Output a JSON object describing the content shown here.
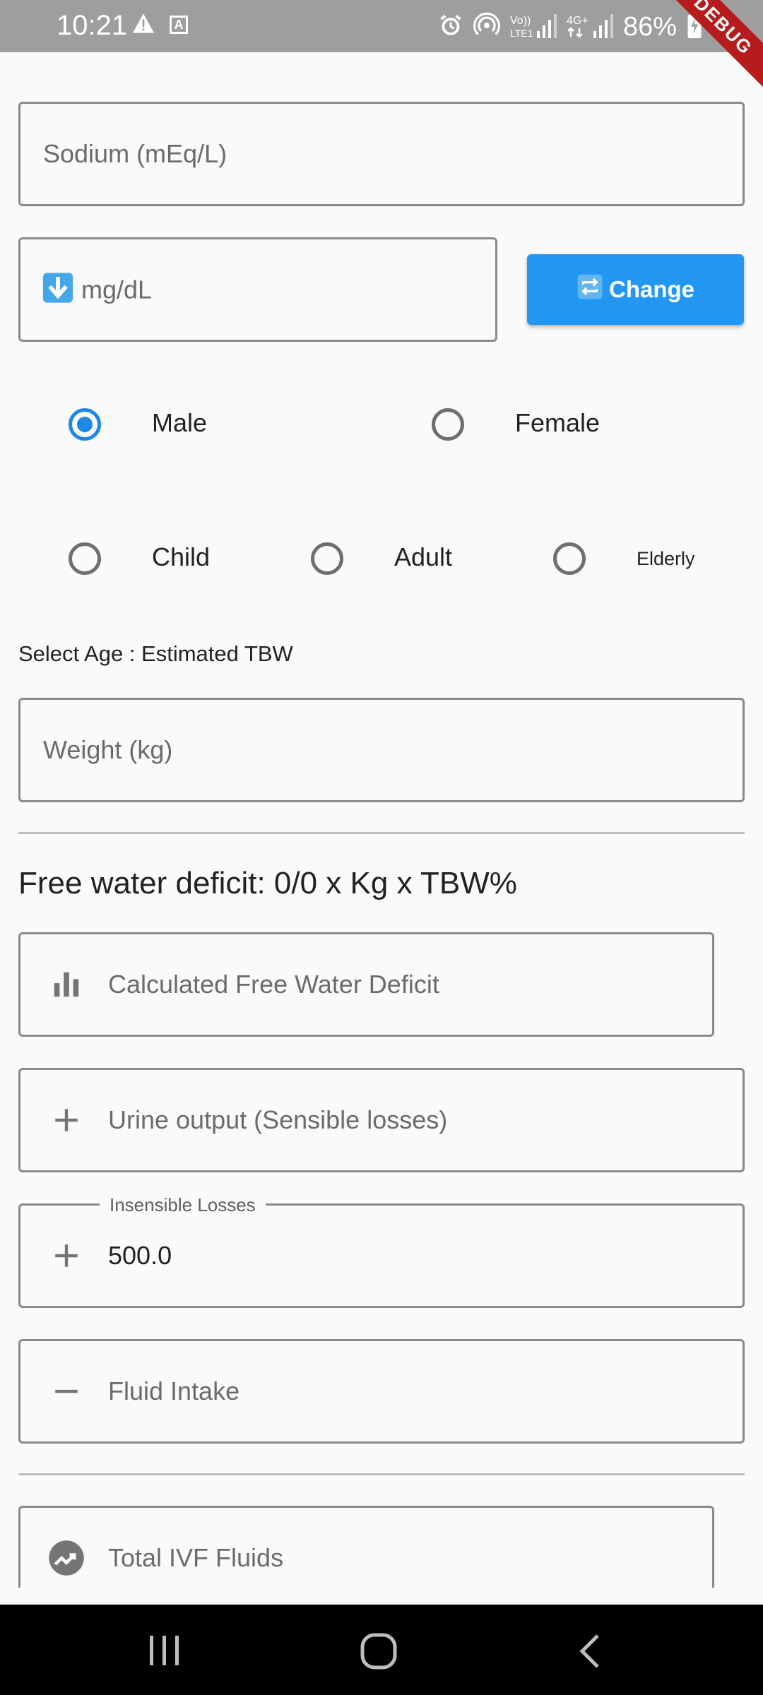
{
  "status_bar": {
    "time": "10:21",
    "battery": "86%",
    "debug_banner": "DEBUG"
  },
  "sodium": {
    "placeholder": "Sodium (mEq/L)"
  },
  "unit": {
    "icon": "down-arrow-emoji",
    "text": "mg/dL"
  },
  "change_button": {
    "label": "Change",
    "icon": "repeat-emoji"
  },
  "sex": {
    "options": [
      "Male",
      "Female"
    ],
    "selected": "Male"
  },
  "age_group": {
    "options": [
      "Child",
      "Adult",
      "Elderly"
    ],
    "selected": null
  },
  "select_age_text": "Select Age : Estimated TBW",
  "weight": {
    "placeholder": "Weight (kg)"
  },
  "formula": "Free water deficit: 0/0 x Kg x TBW%",
  "calc_deficit": {
    "placeholder": "Calculated Free Water Deficit",
    "icon": "bar-chart-icon"
  },
  "urine_output": {
    "placeholder": "Urine output (Sensible losses)",
    "icon": "plus-icon"
  },
  "insensible_losses": {
    "label": "Insensible Losses",
    "value": "500.0",
    "icon": "plus-icon"
  },
  "fluid_intake": {
    "placeholder": "Fluid Intake",
    "icon": "minus-icon"
  },
  "total_ivf": {
    "placeholder": "Total IVF Fluids",
    "icon": "trending-up-icon"
  },
  "colors": {
    "primary": "#2196f3",
    "radio_selected": "#1e88e5",
    "status_bar": "#9e9e9e",
    "debug_banner": "#b71c1c"
  }
}
